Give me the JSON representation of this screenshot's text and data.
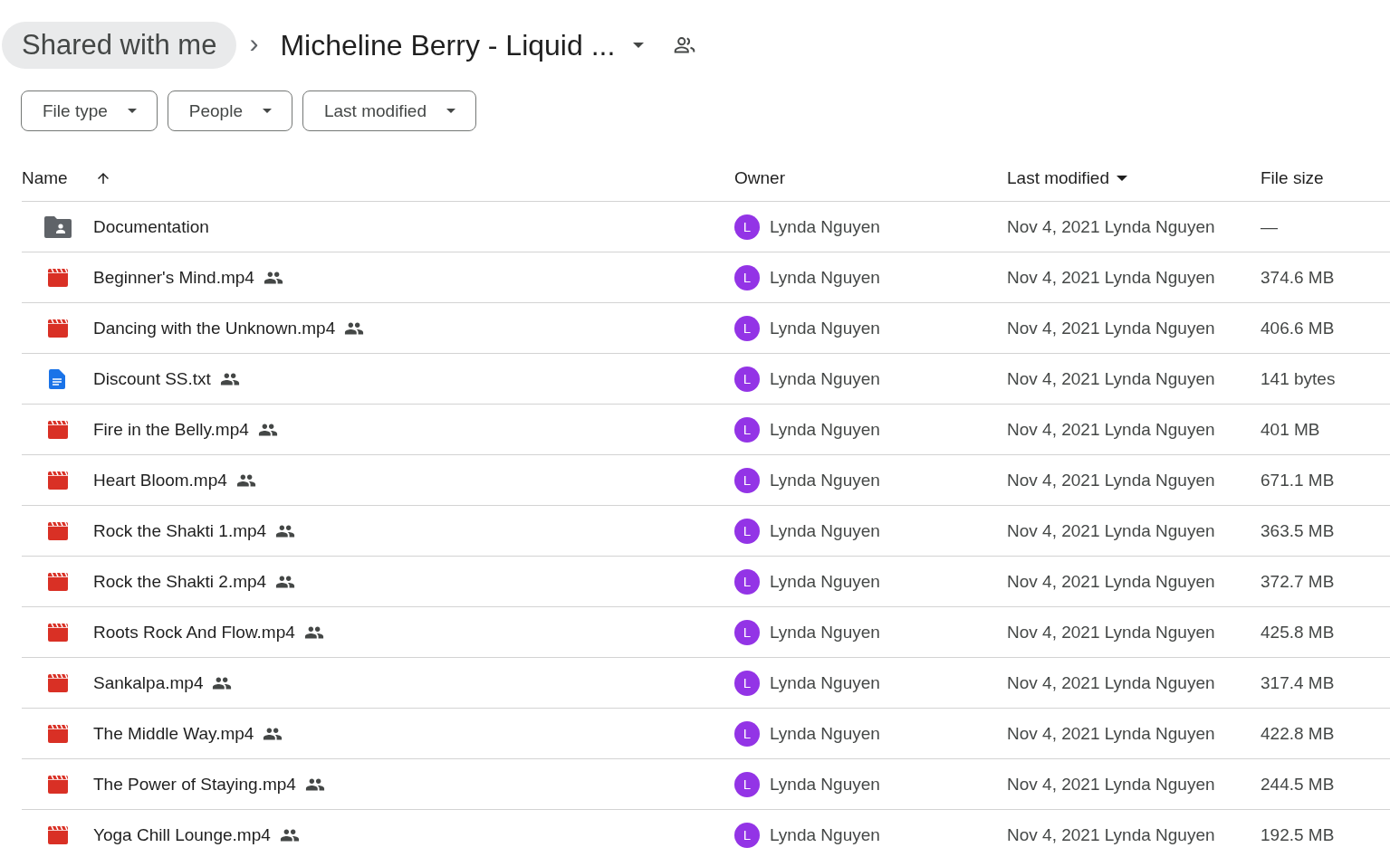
{
  "breadcrumb": {
    "parent": "Shared with me",
    "separator": "›",
    "current": "Micheline Berry - Liquid ...",
    "shared": true
  },
  "filters": [
    {
      "label": "File type"
    },
    {
      "label": "People"
    },
    {
      "label": "Last modified"
    }
  ],
  "table": {
    "columns": [
      {
        "label": "Name",
        "sort_arrow": true,
        "sort_caret": false
      },
      {
        "label": "Owner",
        "sort_arrow": false,
        "sort_caret": false
      },
      {
        "label": "Last modified",
        "sort_arrow": false,
        "sort_caret": true
      },
      {
        "label": "File size",
        "sort_arrow": false,
        "sort_caret": false
      }
    ],
    "rows": [
      {
        "kind": "folder",
        "name": "Documentation",
        "shared": false,
        "owner_initial": "L",
        "owner": "Lynda Nguyen",
        "modified": "Nov 4, 2021 Lynda Nguyen",
        "size": "—"
      },
      {
        "kind": "video",
        "name": "Beginner's Mind.mp4",
        "shared": true,
        "owner_initial": "L",
        "owner": "Lynda Nguyen",
        "modified": "Nov 4, 2021 Lynda Nguyen",
        "size": "374.6 MB"
      },
      {
        "kind": "video",
        "name": "Dancing with the Unknown.mp4",
        "shared": true,
        "owner_initial": "L",
        "owner": "Lynda Nguyen",
        "modified": "Nov 4, 2021 Lynda Nguyen",
        "size": "406.6 MB"
      },
      {
        "kind": "doc",
        "name": "Discount SS.txt",
        "shared": true,
        "owner_initial": "L",
        "owner": "Lynda Nguyen",
        "modified": "Nov 4, 2021 Lynda Nguyen",
        "size": "141 bytes"
      },
      {
        "kind": "video",
        "name": "Fire in the Belly.mp4",
        "shared": true,
        "owner_initial": "L",
        "owner": "Lynda Nguyen",
        "modified": "Nov 4, 2021 Lynda Nguyen",
        "size": "401 MB"
      },
      {
        "kind": "video",
        "name": "Heart Bloom.mp4",
        "shared": true,
        "owner_initial": "L",
        "owner": "Lynda Nguyen",
        "modified": "Nov 4, 2021 Lynda Nguyen",
        "size": "671.1 MB"
      },
      {
        "kind": "video",
        "name": "Rock the Shakti 1.mp4",
        "shared": true,
        "owner_initial": "L",
        "owner": "Lynda Nguyen",
        "modified": "Nov 4, 2021 Lynda Nguyen",
        "size": "363.5 MB"
      },
      {
        "kind": "video",
        "name": "Rock the Shakti 2.mp4",
        "shared": true,
        "owner_initial": "L",
        "owner": "Lynda Nguyen",
        "modified": "Nov 4, 2021 Lynda Nguyen",
        "size": "372.7 MB"
      },
      {
        "kind": "video",
        "name": "Roots Rock And Flow.mp4",
        "shared": true,
        "owner_initial": "L",
        "owner": "Lynda Nguyen",
        "modified": "Nov 4, 2021 Lynda Nguyen",
        "size": "425.8 MB"
      },
      {
        "kind": "video",
        "name": "Sankalpa.mp4",
        "shared": true,
        "owner_initial": "L",
        "owner": "Lynda Nguyen",
        "modified": "Nov 4, 2021 Lynda Nguyen",
        "size": "317.4 MB"
      },
      {
        "kind": "video",
        "name": "The Middle Way.mp4",
        "shared": true,
        "owner_initial": "L",
        "owner": "Lynda Nguyen",
        "modified": "Nov 4, 2021 Lynda Nguyen",
        "size": "422.8 MB"
      },
      {
        "kind": "video",
        "name": "The Power of Staying.mp4",
        "shared": true,
        "owner_initial": "L",
        "owner": "Lynda Nguyen",
        "modified": "Nov 4, 2021 Lynda Nguyen",
        "size": "244.5 MB"
      },
      {
        "kind": "video",
        "name": "Yoga Chill Lounge.mp4",
        "shared": true,
        "owner_initial": "L",
        "owner": "Lynda Nguyen",
        "modified": "Nov 4, 2021 Lynda Nguyen",
        "size": "192.5 MB"
      }
    ]
  }
}
